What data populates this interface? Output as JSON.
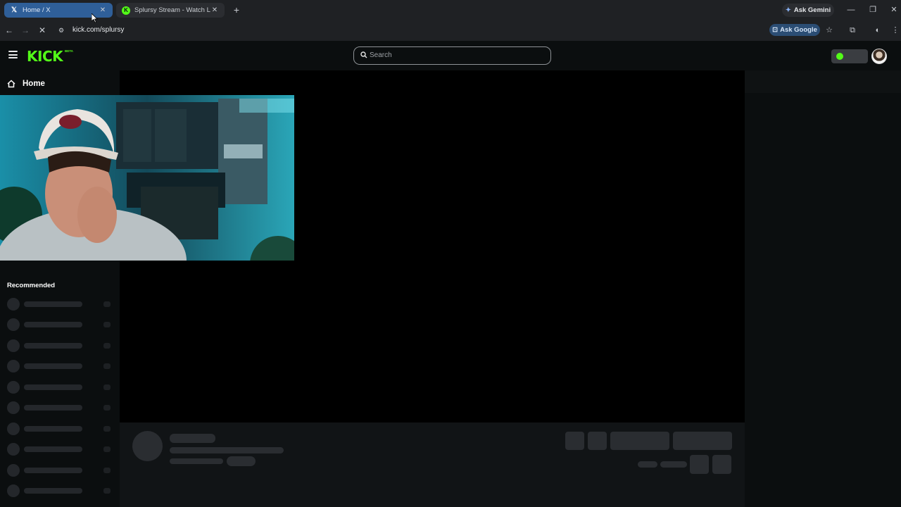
{
  "browser": {
    "tabs": [
      {
        "title": "Home / X",
        "active": true
      },
      {
        "title": "Splursy Stream - Watch Live on Kick",
        "active": false
      }
    ],
    "ask_gemini_label": "Ask Gemini",
    "url": "kick.com/splursy",
    "ask_google_label": "Ask Google"
  },
  "kick": {
    "logo": "KICK",
    "logo_badge": "BETA",
    "search_placeholder": "Search",
    "sidebar": {
      "home_label": "Home",
      "recommended_label": "Recommended"
    },
    "colors": {
      "brand": "#53fc18",
      "background": "#0b0e0f",
      "skeleton": "#2a2d31"
    }
  }
}
